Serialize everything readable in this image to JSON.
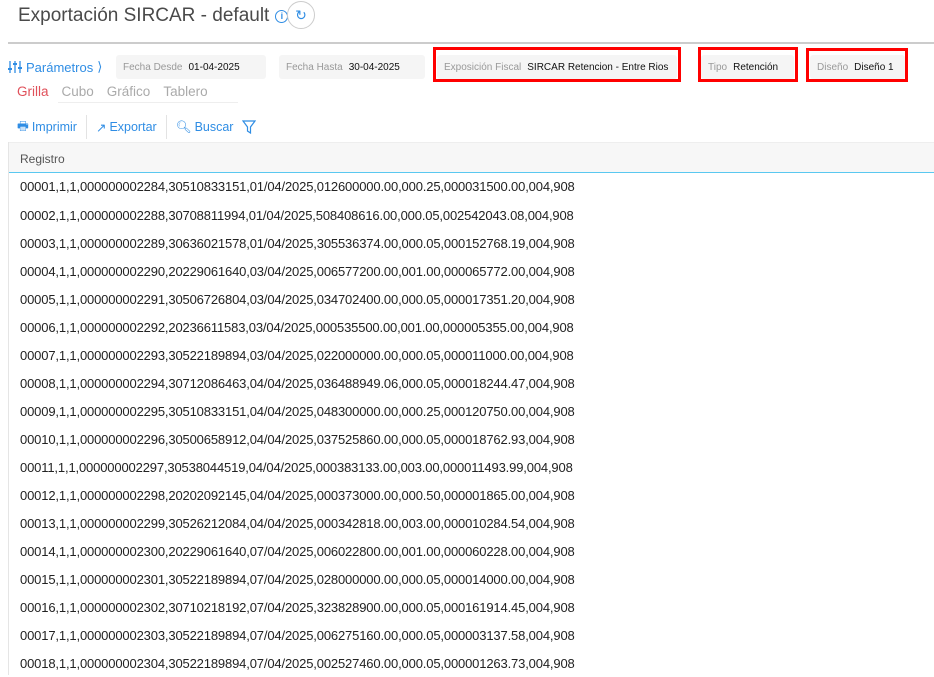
{
  "header": {
    "title": "Exportación SIRCAR - default",
    "info_icon": "info-icon",
    "refresh_icon": "refresh-icon"
  },
  "params": {
    "label": "Parámetros",
    "fecha_desde": {
      "label": "Fecha Desde",
      "value": "01-04-2025"
    },
    "fecha_hasta": {
      "label": "Fecha Hasta",
      "value": "30-04-2025"
    },
    "exposicion": {
      "label": "Exposición Fiscal",
      "value": "SIRCAR Retencion - Entre Rios"
    },
    "tipo": {
      "label": "Tipo",
      "value": "Retención"
    },
    "diseno": {
      "label": "Diseño",
      "value": "Diseño 1"
    },
    "highlight_color": "#ff0000"
  },
  "tabs": [
    {
      "label": "Grilla",
      "active": true
    },
    {
      "label": "Cubo"
    },
    {
      "label": "Gráfico"
    },
    {
      "label": "Tablero"
    }
  ],
  "toolbar": {
    "imprimir": "Imprimir",
    "exportar": "Exportar",
    "buscar": "Buscar"
  },
  "grid": {
    "column": "Registro",
    "rows": [
      "00001,1,1,000000002284,30510833151,01/04/2025,012600000.00,000.25,000031500.00,004,908",
      "00002,1,1,000000002288,30708811994,01/04/2025,508408616.00,000.05,002542043.08,004,908",
      "00003,1,1,000000002289,30636021578,01/04/2025,305536374.00,000.05,000152768.19,004,908",
      "00004,1,1,000000002290,20229061640,03/04/2025,006577200.00,001.00,000065772.00,004,908",
      "00005,1,1,000000002291,30506726804,03/04/2025,034702400.00,000.05,000017351.20,004,908",
      "00006,1,1,000000002292,20236611583,03/04/2025,000535500.00,001.00,000005355.00,004,908",
      "00007,1,1,000000002293,30522189894,03/04/2025,022000000.00,000.05,000011000.00,004,908",
      "00008,1,1,000000002294,30712086463,04/04/2025,036488949.06,000.05,000018244.47,004,908",
      "00009,1,1,000000002295,30510833151,04/04/2025,048300000.00,000.25,000120750.00,004,908",
      "00010,1,1,000000002296,30500658912,04/04/2025,037525860.00,000.05,000018762.93,004,908",
      "00011,1,1,000000002297,30538044519,04/04/2025,000383133.00,003.00,000011493.99,004,908",
      "00012,1,1,000000002298,20202092145,04/04/2025,000373000.00,000.50,000001865.00,004,908",
      "00013,1,1,000000002299,30526212084,04/04/2025,000342818.00,003.00,000010284.54,004,908",
      "00014,1,1,000000002300,20229061640,07/04/2025,006022800.00,001.00,000060228.00,004,908",
      "00015,1,1,000000002301,30522189894,07/04/2025,028000000.00,000.05,000014000.00,004,908",
      "00016,1,1,000000002302,30710218192,07/04/2025,323828900.00,000.05,000161914.45,004,908",
      "00017,1,1,000000002303,30522189894,07/04/2025,006275160.00,000.05,000003137.58,004,908",
      "00018,1,1,000000002304,30522189894,07/04/2025,002527460.00,000.05,000001263.73,004,908"
    ]
  }
}
